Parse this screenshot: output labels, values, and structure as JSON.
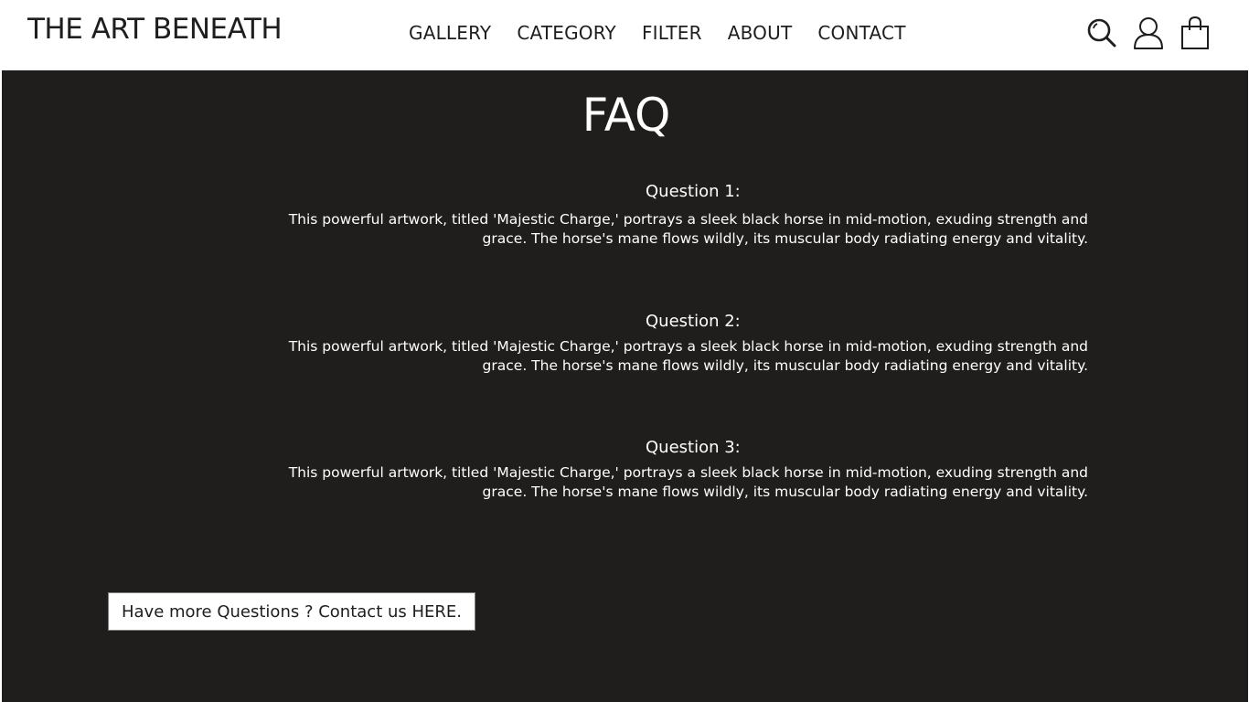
{
  "header": {
    "brand": "THE ART BENEATH",
    "nav": [
      {
        "label": "GALLERY"
      },
      {
        "label": "CATEGORY"
      },
      {
        "label": "FILTER"
      },
      {
        "label": "ABOUT"
      },
      {
        "label": "CONTACT"
      }
    ],
    "icons": [
      "search-icon",
      "user-icon",
      "shopping-bag-icon"
    ]
  },
  "main": {
    "title": "FAQ",
    "faqs": [
      {
        "question": "Question 1:",
        "answer": "This powerful artwork, titled 'Majestic Charge,' portrays a sleek black horse in mid-motion, exuding strength and grace. The horse's mane flows wildly, its muscular body radiating energy and vitality."
      },
      {
        "question": "Question 2:",
        "answer": "This powerful artwork, titled 'Majestic Charge,' portrays a sleek black horse in mid-motion, exuding strength and grace. The horse's mane flows wildly, its muscular body radiating energy and vitality."
      },
      {
        "question": "Question 3:",
        "answer": "This powerful artwork, titled 'Majestic Charge,' portrays a sleek black horse in mid-motion, exuding strength and grace. The horse's mane flows wildly, its muscular body radiating energy and vitality."
      }
    ],
    "contact_button": "Have more Questions ? Contact us HERE."
  },
  "colors": {
    "background_dark": "#1f1e1d",
    "text_light": "#ffffff",
    "header_bg": "#ffffff"
  }
}
